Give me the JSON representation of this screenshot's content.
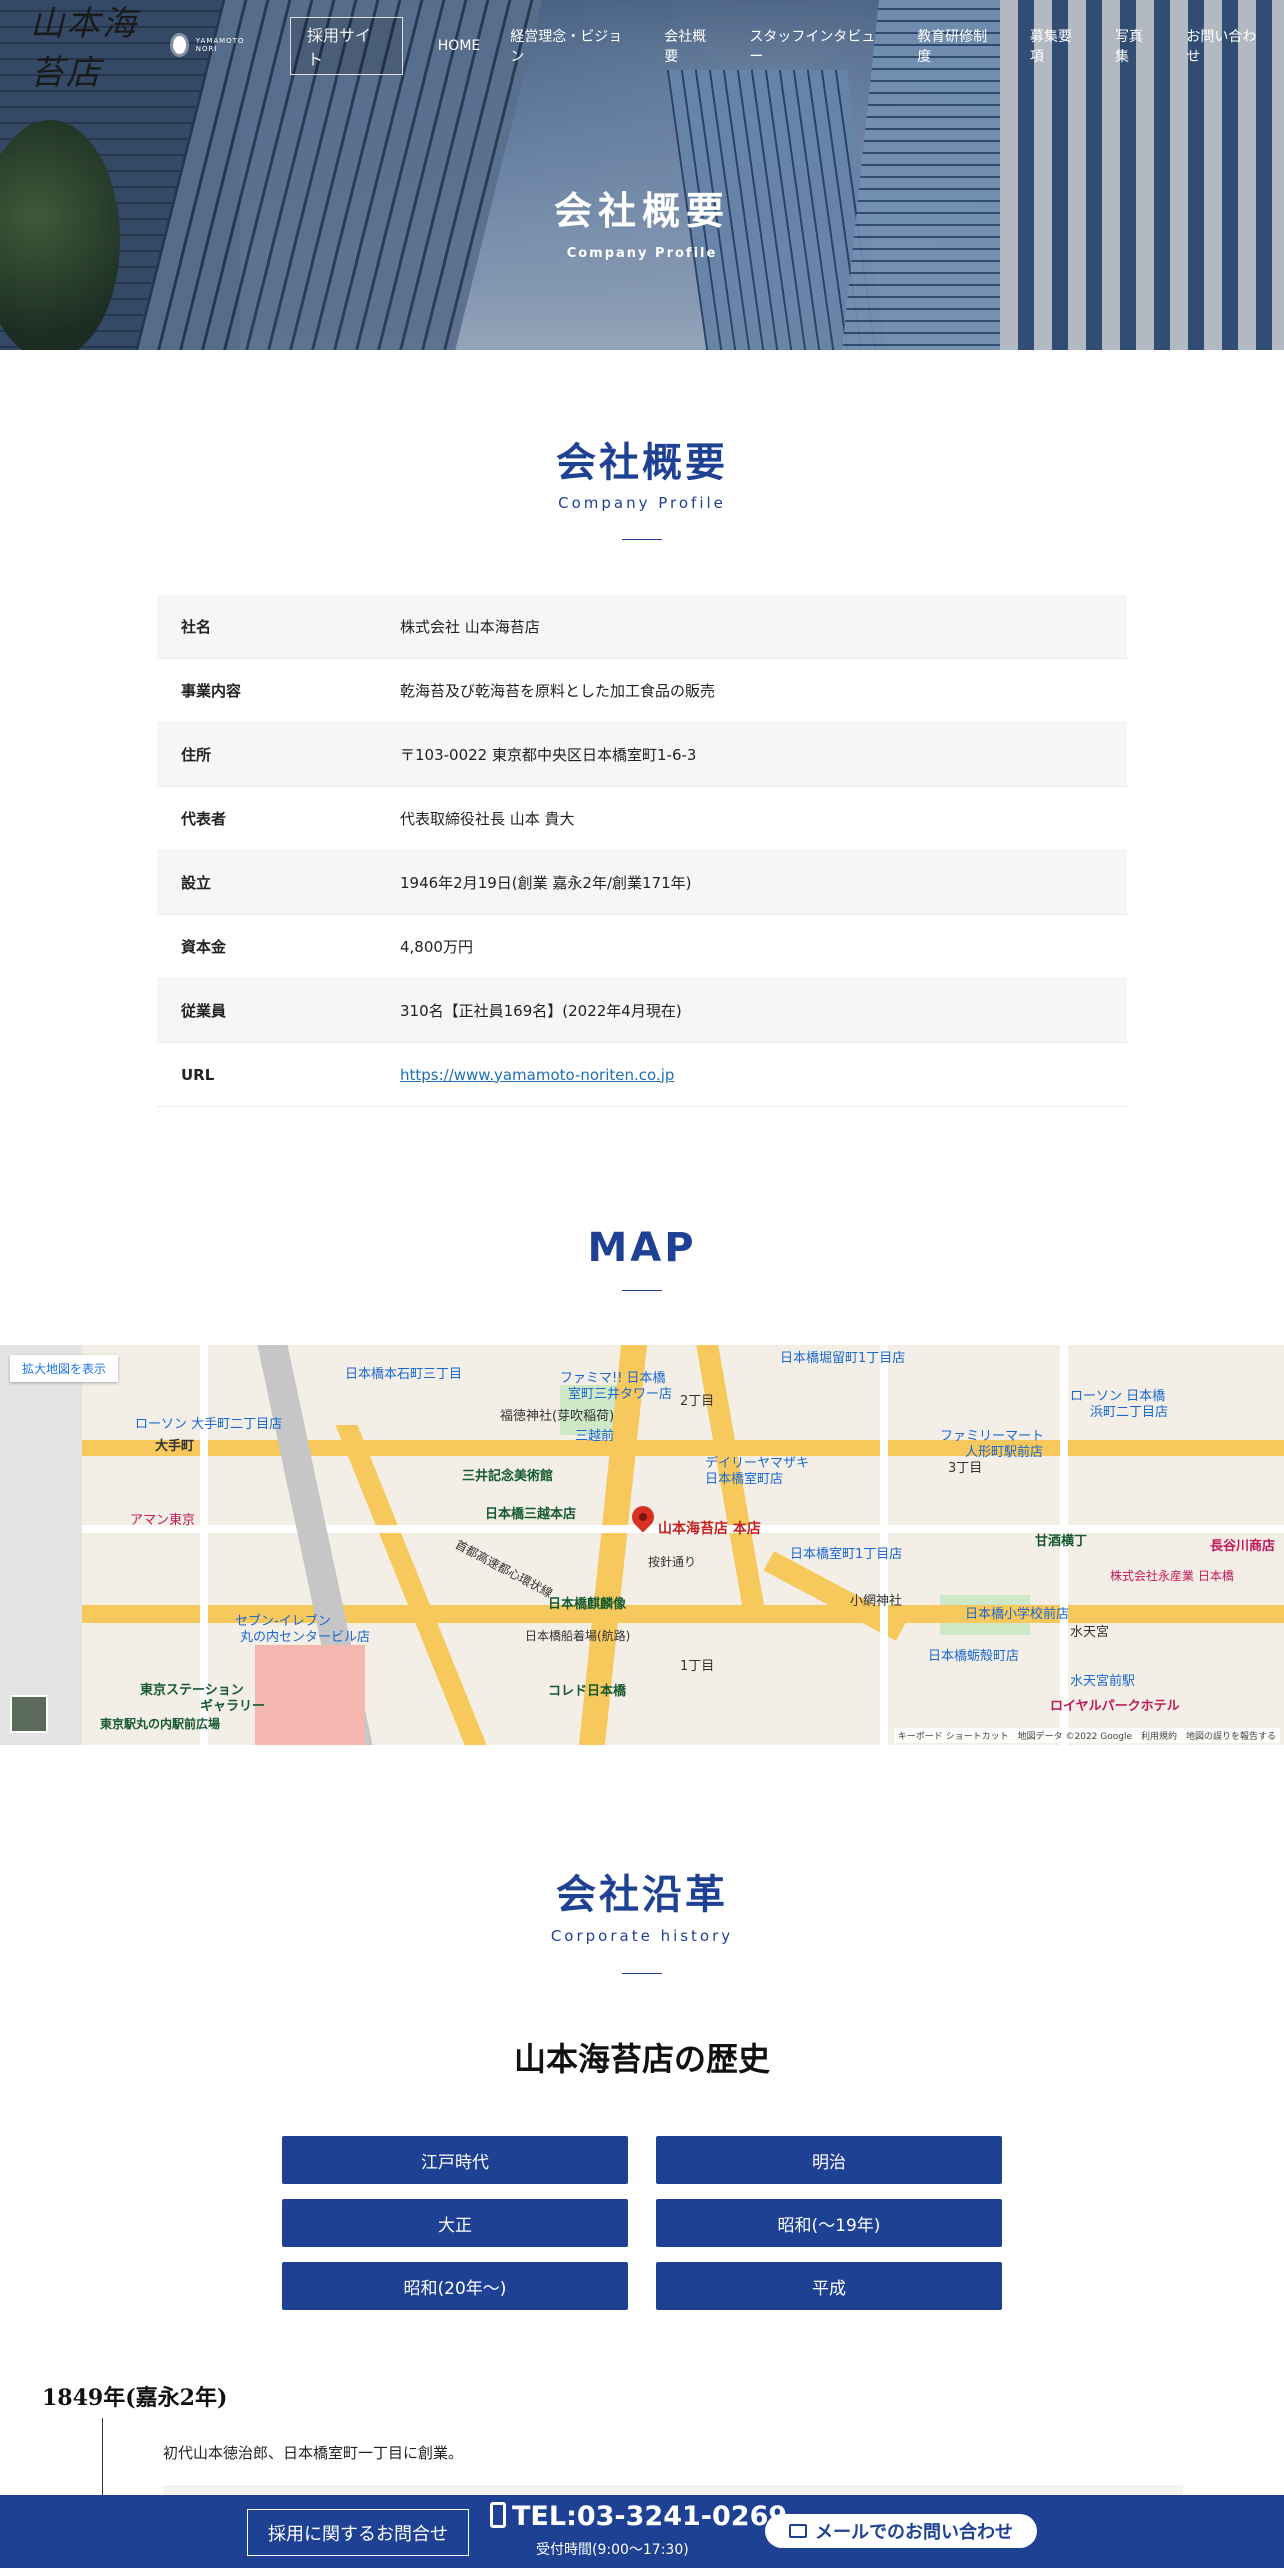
{
  "header": {
    "logo_text": "山本海苔店",
    "logo_sub": "YAMAMOTO NORI",
    "recruit_label": "採用サイト",
    "nav": [
      "HOME",
      "経営理念・ビジョン",
      "会社概要",
      "スタッフインタビュー",
      "教育研修制度",
      "募集要項",
      "写真集",
      "お問い合わせ"
    ]
  },
  "hero": {
    "title": "会社概要",
    "subtitle": "Company Profile"
  },
  "profile": {
    "title": "会社概要",
    "subtitle": "Company Profile",
    "rows": [
      {
        "label": "社名",
        "value": "株式会社 山本海苔店"
      },
      {
        "label": "事業内容",
        "value": "乾海苔及び乾海苔を原料とした加工食品の販売"
      },
      {
        "label": "住所",
        "value": "〒103-0022 東京都中央区日本橋室町1-6-3"
      },
      {
        "label": "代表者",
        "value": "代表取締役社長 山本 貴大"
      },
      {
        "label": "設立",
        "value": "1946年2月19日(創業 嘉永2年/創業171年)"
      },
      {
        "label": "資本金",
        "value": "4,800万円"
      },
      {
        "label": "従業員",
        "value": "310名【正社員169名】(2022年4月現在)"
      },
      {
        "label": "URL",
        "value": "https://www.yamamoto-noriten.co.jp"
      }
    ]
  },
  "map": {
    "title": "MAP",
    "enlarge_label": "拡大地図を表示",
    "pin_label": "山本海苔店 本店",
    "labels": {
      "l1": "ファミマ!! 日本橋",
      "l2": "室町三井タワー店",
      "l3": "福徳神社(芽吹稲荷)",
      "l4": "三越前",
      "l5": "三井記念美術館",
      "l6": "日本橋三越本店",
      "l7": "デイリーヤマザキ",
      "l8": "日本橋室町店",
      "l9": "首都高速都心環状線",
      "l10": "日本橋麒麟像",
      "l11": "日本橋船着場(航路)",
      "l12": "コレド日本橋",
      "l13": "ローソン 大手町二丁目店",
      "l14": "大手町",
      "l15": "アマン東京",
      "l16": "東京ステーション",
      "l17": "ギャラリー",
      "l18": "東京駅丸の内駅前広場",
      "l19": "セブン-イレブン",
      "l20": "丸の内センタービル店",
      "l21": "ファミリーマート",
      "l22": "人形町駅前店",
      "l23": "甘酒横丁",
      "l24": "小網神社",
      "l25": "水天宮",
      "l26": "ロイヤルパークホテル",
      "l27": "長谷川商店",
      "l28": "株式会社永産業 日本橋",
      "l29": "ローソン 日本橋",
      "l30": "浜町二丁目店",
      "l31": "日本橋本石町三丁目",
      "l32": "日本橋堀留町1丁目店",
      "l33": "2丁目",
      "l34": "1丁目",
      "l35": "3丁目",
      "l36": "按針通り",
      "l37": "日本橋室町1丁目店",
      "l38": "日本橋小学校前店",
      "l39": "日本橋蛎殻町店",
      "l40": "水天宮前駅"
    },
    "footer": "キーボード ショートカット　地図データ ©2022 Google　利用規約　地図の誤りを報告する"
  },
  "history": {
    "title": "会社沿革",
    "subtitle": "Corporate history",
    "heading": "山本海苔店の歴史",
    "eras": [
      "江戸時代",
      "明治",
      "大正",
      "昭和(～19年)",
      "昭和(20年～)",
      "平成"
    ],
    "entries": [
      {
        "year": "1849年(嘉永2年)",
        "text": "初代山本徳治郎、日本橋室町一丁目に創業。"
      }
    ]
  },
  "footer_bar": {
    "contact_label": "採用に関するお問合せ",
    "tel": "TEL:03-3241-0269",
    "hours": "受付時間(9:00～17:30)",
    "mail_label": "メールでのお問い合わせ"
  }
}
